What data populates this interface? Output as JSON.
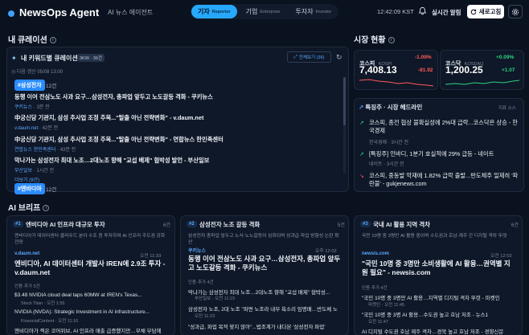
{
  "header": {
    "logo": "NewsOps Agent",
    "subtitle": "AI 뉴스 에이전트",
    "modes": [
      {
        "label": "기자",
        "en": "Reporter",
        "active": true
      },
      {
        "label": "기업",
        "en": "Enterprise",
        "active": false
      },
      {
        "label": "투자자",
        "en": "Investor",
        "active": false
      }
    ],
    "time": "12:42:09 KST",
    "alert_label": "실시간 알림",
    "refresh_label": "새로고침"
  },
  "curation": {
    "section_title": "내 큐레이션",
    "card_title": "내 키워드별 큐레이션",
    "badge": "3KW · 36건",
    "expand_label": "전체보기 (36)",
    "date_line": "다음 갱신 05/08 13:00",
    "group_tag": "#삼성전자",
    "group_count": "12건",
    "items": [
      {
        "title": "동행 이어 전삼노도 사과 요구…삼성전자, 총파업 앞두고 노도갈등 격화 - 쿠키뉴스",
        "source": "쿠키뉴스",
        "time": "3분 전"
      },
      {
        "title": "中궁신당 기관지, 삼성 추사업 조정 주목...\"탈출 아닌 전략변화\" - v.daum.net",
        "source": "v.daum.net",
        "time": "42분 전"
      },
      {
        "title": "中궁신당 기관지, 삼성 추사업 조정 주목...\"탈출 아닌 전략변화\" - 연합뉴스 한민족센터",
        "source": "연합뉴스 한민족센터",
        "time": "43분 전"
      },
      {
        "title": "막나가는 삼성전자 최대 노조…2대노조 향해 \"교섭 배제\" 협박성 발언 - 부산일보",
        "source": "부산일보",
        "time": "1시간 전"
      }
    ],
    "more_label": "더보기 (9건)",
    "next_tag": "#엔비디아",
    "next_count": "12건"
  },
  "market": {
    "section_title": "시장 현황",
    "indices": [
      {
        "name": "코스피",
        "en": "KOSPI",
        "pct": "-1.09%",
        "value": "7,408.13",
        "chg": "-81.92",
        "dir": "down"
      },
      {
        "name": "코스닥",
        "en": "KOSDAQ",
        "pct": "+0.09%",
        "value": "1,200.25",
        "chg": "+1.07",
        "dir": "up"
      }
    ],
    "headline_title": "특징주 · 시장 헤드라인",
    "headline_meta": "지표 소스",
    "headlines": [
      {
        "title": "코스피, 종전 협상 불확실성에 2%대 급락...코스닥은 상승 - 한국경제",
        "source": "한국경제",
        "time": "3시간 전"
      },
      {
        "title": "[특징주] 인바디, 1분기 호실적에 29% 급등 - 네이트",
        "source": "네이트",
        "time": "3시간 전"
      },
      {
        "title": "코스피, 중동발 악재에 1.82% 급락 출발...반도체주 일제히 '파란불' - gukjenews.com",
        "source": "gukjenews.com",
        "time": ""
      }
    ]
  },
  "brief": {
    "section_title": "AI 브리프",
    "cards": [
      {
        "num": "#1",
        "title": "엔비디아 AI 인프라 대규모 투자",
        "count": "6건",
        "summary": "엔비디아가 데이터센터·클라우드 분야 수조 원 투자하여 AI 인프라 주도권 강화 전망",
        "source": "v.daum.net",
        "time": "오전 11:33",
        "head": "엔비디아, AI 데이터센터 개발사 IREN에 2.9조 투자 - v.daum.net",
        "related_label": "인용·추가 5건",
        "subs": [
          {
            "title": "$3.48 NVIDIA cloud deal taps 60MW at IREN's Texas...",
            "source": "Stock Titan",
            "time": "오전 1:55"
          },
          {
            "title": "NVIDIA (NVDA): Strategic Investment in AI infrastructure...",
            "source": "FinancialContent",
            "time": "오전 11:16"
          },
          {
            "title": "엔비디아가 찍은 코어위브, AI 인프라 매출 급증했지만…부채 부담에",
            "source": "",
            "time": ""
          }
        ]
      },
      {
        "num": "#2",
        "title": "삼성전자 노조 갈등 격화",
        "count": "5건",
        "summary": "삼성전자 총파업 앞두고 노사·노노갈등이 심화되며 성과급·파업 방향성 논란 확산",
        "source": "쿠키뉴스",
        "time": "오후 12:02",
        "head": "동행 이어 전삼노도 사과 요구…삼성전자, 총파업 앞두고 노도갈등 격화 - 쿠키뉴스",
        "related_label": "인용·추가 4건",
        "subs": [
          {
            "title": "막나가는 삼성전자 최대 노조…2대노조 향해 \"교섭 배제\" 협박성...",
            "source": "부산일보",
            "time": "오전 11:15"
          },
          {
            "title": "삼성전자 노조, 2대 노조 \"파면 노조라 내부 욕소리 임명배…반도체 노",
            "source": "",
            "time": "오전 11:23"
          },
          {
            "title": "\"성과급, 파업 목적 맞지 않아\"...법조계가 내다본 '삼성전자 파업'",
            "source": "",
            "time": ""
          }
        ]
      },
      {
        "num": "#3",
        "title": "국내 AI 활용 지역 격차",
        "count": "6건",
        "summary": "국민 10명 중 3명만 AI 활용 중이며 수도권과 호남·제주 간 디지털 격차 뚜렷",
        "source": "newsis.com",
        "time": "오전 12:02",
        "head": "\"국민 10명 중 3명만 소비생활에 AI 활용…권역별 지원 필요\" - newsis.com",
        "related_label": "인용·추가 4건",
        "subs": [
          {
            "title": "\"국민 10명 중 3명만 AI 활용…지역별 디지털 격차 뚜렷 - 마켓인",
            "source": "마켓인",
            "time": "오전 11:45"
          },
          {
            "title": "\"국민 10명 중 3명 AI 활용…수도권 높고 호남 저조 - 뉴스1",
            "source": "",
            "time": "오전 11:47"
          },
          {
            "title": "AI 디지털 수도권 호남 제주 격차…경북 높고 호남 저조 - 경향신문",
            "source": "",
            "time": ""
          }
        ]
      }
    ]
  }
}
